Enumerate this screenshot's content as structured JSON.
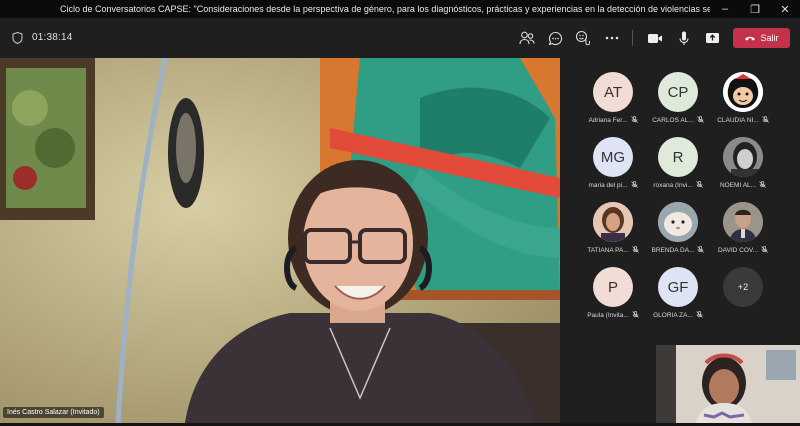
{
  "window": {
    "title": "Ciclo de Conversatorios CAPSE: \"Consideraciones desde la perspectiva de género, para los diagnósticos, prácticas y experiencias en la detección de violencias sexuales\"",
    "controls": [
      "minimize-icon",
      "restore-icon",
      "close-icon"
    ]
  },
  "toolbar": {
    "timer": "01:38:14",
    "icons": [
      "participants-icon",
      "chat-icon",
      "reactions-icon",
      "more-icon",
      "camera-icon",
      "microphone-icon",
      "share-icon"
    ],
    "leave_label": "Salir",
    "leave_color": "#c4314b"
  },
  "stage": {
    "speaker_name": "Inés Castro Salazar (Invitado)"
  },
  "participants": [
    {
      "initials": "AT",
      "name": "Adriana Fer...",
      "bg": "#f2ddd6",
      "muted": true
    },
    {
      "initials": "CP",
      "name": "CARLOS AL...",
      "bg": "#dfeadb",
      "muted": true
    },
    {
      "initials": "",
      "name": "CLAUDIA NI...",
      "bg": "#ffffff",
      "muted": true,
      "photo": "cartoon"
    },
    {
      "initials": "MG",
      "name": "maria del pi...",
      "bg": "#dfe4f5",
      "muted": true
    },
    {
      "initials": "R",
      "name": "roxana (Invi...",
      "bg": "#dfeadb",
      "muted": true
    },
    {
      "initials": "",
      "name": "NOEMI AL...",
      "bg": "#777777",
      "muted": true,
      "photo": "bw"
    },
    {
      "initials": "",
      "name": "TATIANA PA...",
      "bg": "#d9a88a",
      "muted": true,
      "photo": "woman"
    },
    {
      "initials": "",
      "name": "BRENDA DA...",
      "bg": "#b9c3c8",
      "muted": true,
      "photo": "pet"
    },
    {
      "initials": "",
      "name": "DAVID COV...",
      "bg": "#8d8a82",
      "muted": true,
      "photo": "man"
    },
    {
      "initials": "P",
      "name": "Paula (Invita...",
      "bg": "#f2ddd6",
      "muted": true
    },
    {
      "initials": "GF",
      "name": "GLORIA ZA...",
      "bg": "#dfe4f5",
      "muted": true
    },
    {
      "initials": "+2",
      "name": "",
      "bg": "#3a3a3a",
      "muted": false
    }
  ]
}
